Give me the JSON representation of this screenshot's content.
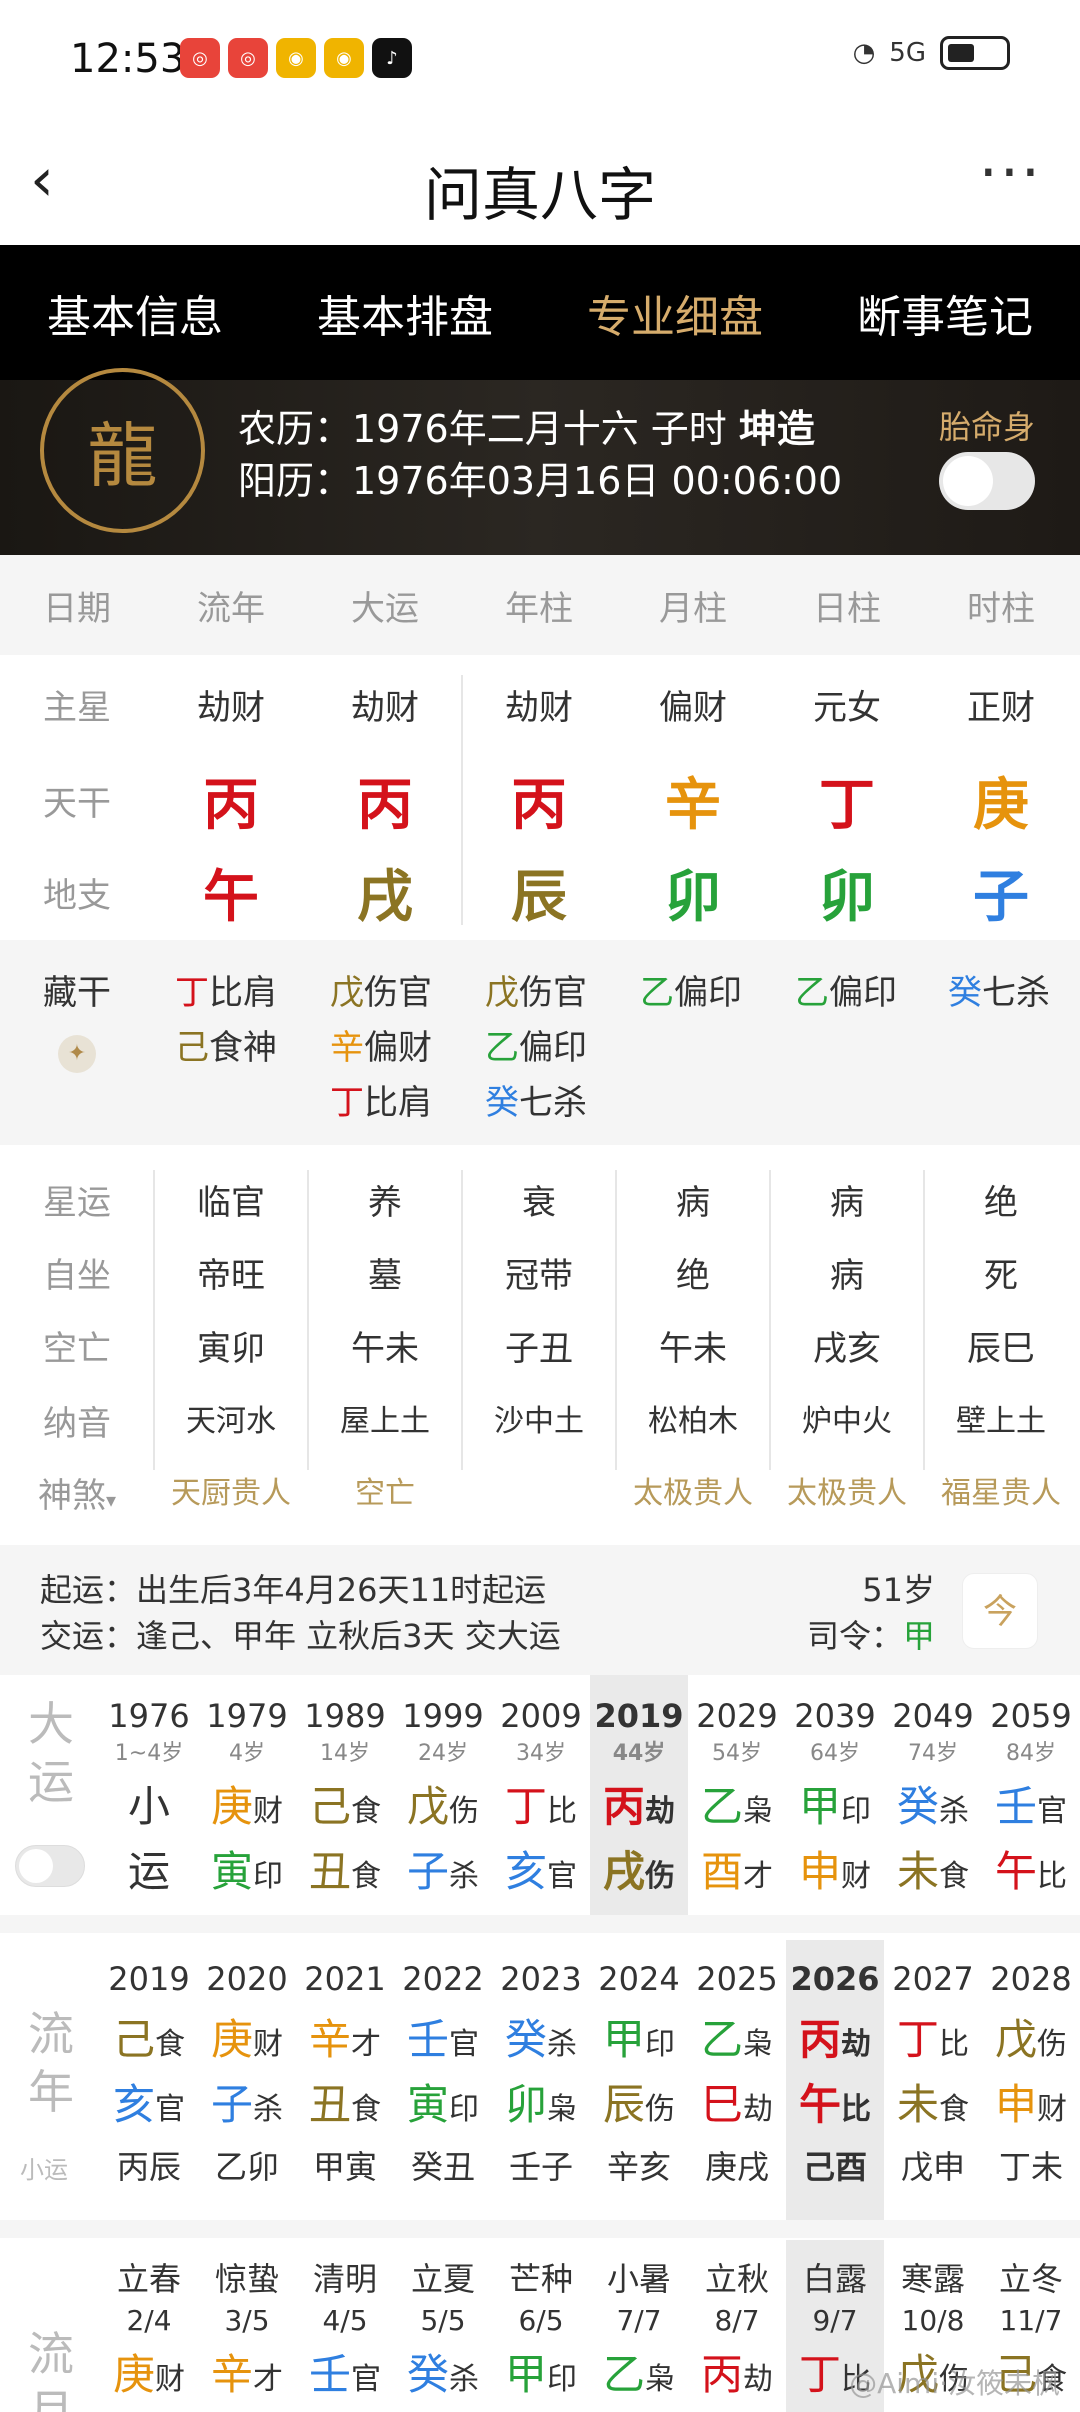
{
  "status": {
    "time": "12:53",
    "net": "5G"
  },
  "titlebar": {
    "title": "问真八字",
    "back": "‹",
    "more": "···"
  },
  "tabs": [
    "基本信息",
    "基本排盘",
    "专业细盘",
    "断事笔记"
  ],
  "header": {
    "lunar": "农历：1976年二月十六 子时",
    "gender": "坤造",
    "solar": "阳历：1976年03月16日 00:06:00",
    "taiming": "胎命身"
  },
  "cols": [
    "日期",
    "流年",
    "大运",
    "年柱",
    "月柱",
    "日柱",
    "时柱"
  ],
  "zhuxing": {
    "label": "主星",
    "values": [
      "劫财",
      "劫财",
      "劫财",
      "偏财",
      "元女",
      "正财"
    ]
  },
  "tiangan": {
    "label": "天干",
    "values": [
      "丙",
      "丙",
      "丙",
      "辛",
      "丁",
      "庚"
    ]
  },
  "dizhi": {
    "label": "地支",
    "values": [
      "午",
      "戌",
      "辰",
      "卯",
      "卯",
      "子"
    ]
  },
  "canggan_label": "藏干",
  "canggan": [
    [
      [
        "丁",
        "比肩"
      ],
      [
        "己",
        "食神"
      ]
    ],
    [
      [
        "戊",
        "伤官"
      ],
      [
        "辛",
        "偏财"
      ],
      [
        "丁",
        "比肩"
      ]
    ],
    [
      [
        "戊",
        "伤官"
      ],
      [
        "乙",
        "偏印"
      ],
      [
        "癸",
        "七杀"
      ]
    ],
    [
      [
        "乙",
        "偏印"
      ]
    ],
    [
      [
        "乙",
        "偏印"
      ]
    ],
    [
      [
        "癸",
        "七杀"
      ]
    ]
  ],
  "xingyun": {
    "label": "星运",
    "values": [
      "临官",
      "养",
      "衰",
      "病",
      "病",
      "绝"
    ]
  },
  "zizuo": {
    "label": "自坐",
    "values": [
      "帝旺",
      "墓",
      "冠带",
      "绝",
      "病",
      "死"
    ]
  },
  "kongwang": {
    "label": "空亡",
    "values": [
      "寅卯",
      "午未",
      "子丑",
      "午未",
      "戌亥",
      "辰巳"
    ]
  },
  "nayin": {
    "label": "纳音",
    "values": [
      "天河水",
      "屋上土",
      "沙中土",
      "松柏木",
      "炉中火",
      "壁上土"
    ]
  },
  "shensha": {
    "label": "神煞",
    "values": [
      "天厨贵人",
      "空亡",
      "",
      "太极贵人",
      "太极贵人",
      "福星贵人"
    ]
  },
  "qiyun": {
    "line1": "起运：出生后3年4月26天11时起运",
    "line2": "交运：逢己、甲年 立秋后3天 交大运",
    "age": "51岁",
    "siling": "司令：",
    "siling_val": "甲",
    "icon": "今"
  },
  "dayun": {
    "label1": "大",
    "label2": "运",
    "cols": [
      {
        "y": "1976",
        "a": "1~4岁",
        "g": "小",
        "z": "运",
        "gs": "",
        "zs": ""
      },
      {
        "y": "1979",
        "a": "4岁",
        "g": "庚",
        "gs": "财",
        "z": "寅",
        "zs": "印"
      },
      {
        "y": "1989",
        "a": "14岁",
        "g": "己",
        "gs": "食",
        "z": "丑",
        "zs": "食"
      },
      {
        "y": "1999",
        "a": "24岁",
        "g": "戊",
        "gs": "伤",
        "z": "子",
        "zs": "杀"
      },
      {
        "y": "2009",
        "a": "34岁",
        "g": "丁",
        "gs": "比",
        "z": "亥",
        "zs": "官"
      },
      {
        "y": "2019",
        "a": "44岁",
        "g": "丙",
        "gs": "劫",
        "z": "戌",
        "zs": "伤"
      },
      {
        "y": "2029",
        "a": "54岁",
        "g": "乙",
        "gs": "枭",
        "z": "酉",
        "zs": "才"
      },
      {
        "y": "2039",
        "a": "64岁",
        "g": "甲",
        "gs": "印",
        "z": "申",
        "zs": "财"
      },
      {
        "y": "2049",
        "a": "74岁",
        "g": "癸",
        "gs": "杀",
        "z": "未",
        "zs": "食"
      },
      {
        "y": "2059",
        "a": "84岁",
        "g": "壬",
        "gs": "官",
        "z": "午",
        "zs": "比"
      }
    ]
  },
  "liunian": {
    "label1": "流",
    "label2": "年",
    "label3": "小运",
    "cols": [
      {
        "y": "2019",
        "g": "己",
        "gs": "食",
        "z": "亥",
        "zs": "官",
        "x": "丙辰"
      },
      {
        "y": "2020",
        "g": "庚",
        "gs": "财",
        "z": "子",
        "zs": "杀",
        "x": "乙卯"
      },
      {
        "y": "2021",
        "g": "辛",
        "gs": "才",
        "z": "丑",
        "zs": "食",
        "x": "甲寅"
      },
      {
        "y": "2022",
        "g": "壬",
        "gs": "官",
        "z": "寅",
        "zs": "印",
        "x": "癸丑"
      },
      {
        "y": "2023",
        "g": "癸",
        "gs": "杀",
        "z": "卯",
        "zs": "枭",
        "x": "壬子"
      },
      {
        "y": "2024",
        "g": "甲",
        "gs": "印",
        "z": "辰",
        "zs": "伤",
        "x": "辛亥"
      },
      {
        "y": "2025",
        "g": "乙",
        "gs": "枭",
        "z": "巳",
        "zs": "劫",
        "x": "庚戌"
      },
      {
        "y": "2026",
        "g": "丙",
        "gs": "劫",
        "z": "午",
        "zs": "比",
        "x": "己酉"
      },
      {
        "y": "2027",
        "g": "丁",
        "gs": "比",
        "z": "未",
        "zs": "食",
        "x": "戊申"
      },
      {
        "y": "2028",
        "g": "戊",
        "gs": "伤",
        "z": "申",
        "zs": "财",
        "x": "丁未"
      }
    ]
  },
  "liuyue": {
    "label1": "流",
    "label2": "月",
    "cols": [
      {
        "t": "立春",
        "d": "2/4",
        "g": "庚",
        "gs": "财"
      },
      {
        "t": "惊蛰",
        "d": "3/5",
        "g": "辛",
        "gs": "才"
      },
      {
        "t": "清明",
        "d": "4/5",
        "g": "壬",
        "gs": "官"
      },
      {
        "t": "立夏",
        "d": "5/5",
        "g": "癸",
        "gs": "杀"
      },
      {
        "t": "芒种",
        "d": "6/5",
        "g": "甲",
        "gs": "印"
      },
      {
        "t": "小暑",
        "d": "7/7",
        "g": "乙",
        "gs": "枭"
      },
      {
        "t": "立秋",
        "d": "8/7",
        "g": "丙",
        "gs": "劫"
      },
      {
        "t": "白露",
        "d": "9/7",
        "g": "丁",
        "gs": "比"
      },
      {
        "t": "寒露",
        "d": "10/8",
        "g": "戊",
        "gs": "伤"
      },
      {
        "t": "立冬",
        "d": "11/7",
        "g": "己",
        "gs": "食"
      }
    ]
  },
  "watermark": "@Aimi·汝筱未枫"
}
